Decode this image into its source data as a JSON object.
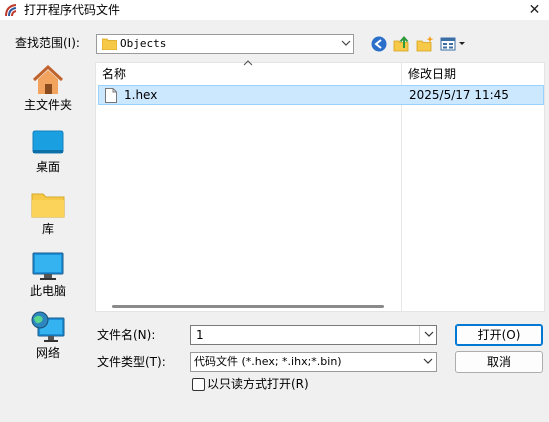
{
  "window": {
    "title": "打开程序代码文件",
    "close_glyph": "✕"
  },
  "lookin": {
    "label": "查找范围(I):",
    "value": "Objects"
  },
  "toolbar": {
    "icons": [
      "back-icon",
      "up-folder-icon",
      "new-folder-icon",
      "view-menu-icon"
    ]
  },
  "places": [
    {
      "label": "主文件夹",
      "icon": "home-icon"
    },
    {
      "label": "桌面",
      "icon": "desktop-icon"
    },
    {
      "label": "库",
      "icon": "library-folder-icon"
    },
    {
      "label": "此电脑",
      "icon": "computer-icon"
    },
    {
      "label": "网络",
      "icon": "network-icon"
    }
  ],
  "filelist": {
    "columns": {
      "name": "名称",
      "date": "修改日期"
    },
    "rows": [
      {
        "name": "1.hex",
        "date": "2025/5/17 11:45"
      }
    ]
  },
  "fields": {
    "filename_label": "文件名(N):",
    "filename_value": "1",
    "filetype_label": "文件类型(T):",
    "filetype_value": "代码文件 (*.hex;  *.ihx;*.bin)"
  },
  "buttons": {
    "open": "打开(O)",
    "cancel": "取消"
  },
  "readonly": {
    "label": "以只读方式打开(R)",
    "checked": false
  },
  "colors": {
    "selection": "#cce8ff",
    "accent": "#0078d4"
  }
}
